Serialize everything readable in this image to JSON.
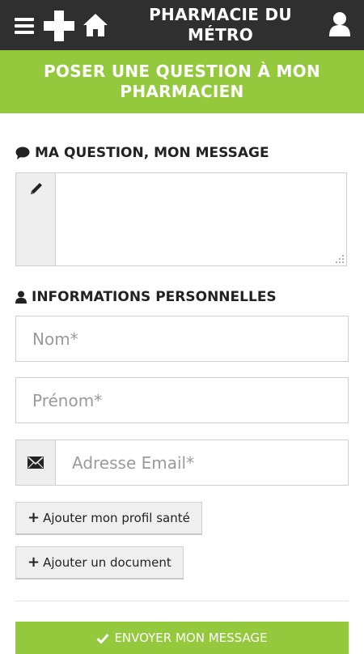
{
  "header": {
    "title": "PHARMACIE DU MÉTRO",
    "icons": [
      "menu-icon",
      "pharmacy-cross-icon",
      "home-icon",
      "user-icon"
    ],
    "background_color": "#2f2f2f"
  },
  "banner": {
    "text": "POSER UNE QUESTION À MON PHARMACIEN",
    "color": "#94c93d"
  },
  "question_section": {
    "title": "MA QUESTION, MON MESSAGE",
    "icon": "comment-icon",
    "textarea_value": "",
    "textarea_icon": "pencil-icon"
  },
  "personal_section": {
    "title": "INFORMATIONS PERSONNELLES",
    "icon": "user-icon",
    "fields": {
      "nom_placeholder": "Nom*",
      "prenom_placeholder": "Prénom*",
      "email_placeholder": "Adresse Email*",
      "email_icon": "envelope-icon"
    }
  },
  "buttons": {
    "add_profile": "Ajouter mon profil santé",
    "add_document": "Ajouter un document",
    "send": "ENVOYER MON MESSAGE",
    "send_icon": "check-icon"
  }
}
